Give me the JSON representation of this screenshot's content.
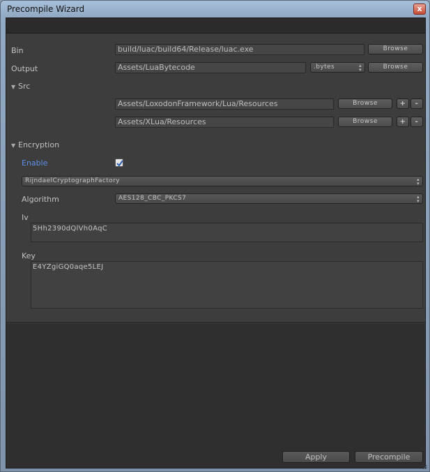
{
  "window": {
    "title": "Precompile Wizard",
    "close_glyph": "x"
  },
  "bin": {
    "label": "Bin",
    "value": "build/luac/build64/Release/luac.exe",
    "browse": "Browse"
  },
  "output": {
    "label": "Output",
    "value": "Assets/LuaBytecode",
    "ext": ".bytes",
    "browse": "Browse"
  },
  "src": {
    "label": "Src",
    "paths": [
      {
        "value": "Assets/LoxodonFramework/Lua/Resources",
        "browse": "Browse",
        "add": "+",
        "remove": "-"
      },
      {
        "value": "Assets/XLua/Resources",
        "browse": "Browse",
        "add": "+",
        "remove": "-"
      }
    ]
  },
  "encryption": {
    "label": "Encryption",
    "enable_label": "Enable",
    "enabled": true,
    "factory": "RijndaelCryptographFactory",
    "algorithm_label": "Algorithm",
    "algorithm": "AES128_CBC_PKCS7",
    "iv_label": "Iv",
    "iv": "5Hh2390dQlVh0AqC",
    "key_label": "Key",
    "key": "E4YZgiGQ0aqe5LEJ"
  },
  "footer": {
    "apply": "Apply",
    "precompile": "Precompile"
  },
  "colors": {
    "link_blue": "#5e8fe8",
    "panel": "#3d3d3d",
    "close": "#c64b35"
  }
}
